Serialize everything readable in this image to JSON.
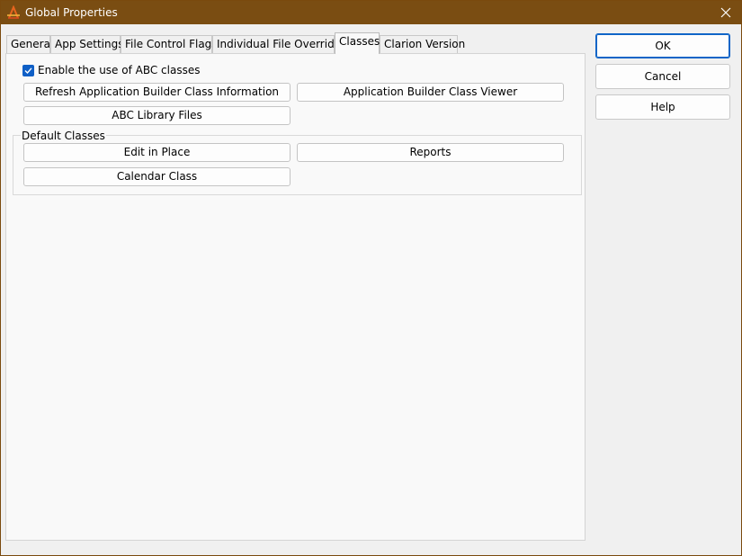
{
  "window": {
    "title": "Global Properties",
    "accent": "#7a4d12"
  },
  "tabs": [
    {
      "label": "General"
    },
    {
      "label": "App Settings"
    },
    {
      "label": "File Control Flags"
    },
    {
      "label": "Individual File Overrides"
    },
    {
      "label": "Classes"
    },
    {
      "label": "Clarion Version"
    }
  ],
  "active_tab": "Classes",
  "classes": {
    "enable_abc_label": "Enable the use of ABC classes",
    "enable_abc_checked": true,
    "refresh_button": "Refresh Application Builder Class Information",
    "viewer_button": "Application Builder Class Viewer",
    "abc_library_button": "ABC Library Files",
    "default_classes": {
      "label": "Default Classes",
      "edit_in_place_button": "Edit in Place",
      "reports_button": "Reports",
      "calendar_class_button": "Calendar Class"
    }
  },
  "side_buttons": {
    "ok": "OK",
    "cancel": "Cancel",
    "help": "Help"
  },
  "icons": {
    "app": "clarion-app-icon",
    "close": "close-icon",
    "check": "checkmark-icon"
  }
}
